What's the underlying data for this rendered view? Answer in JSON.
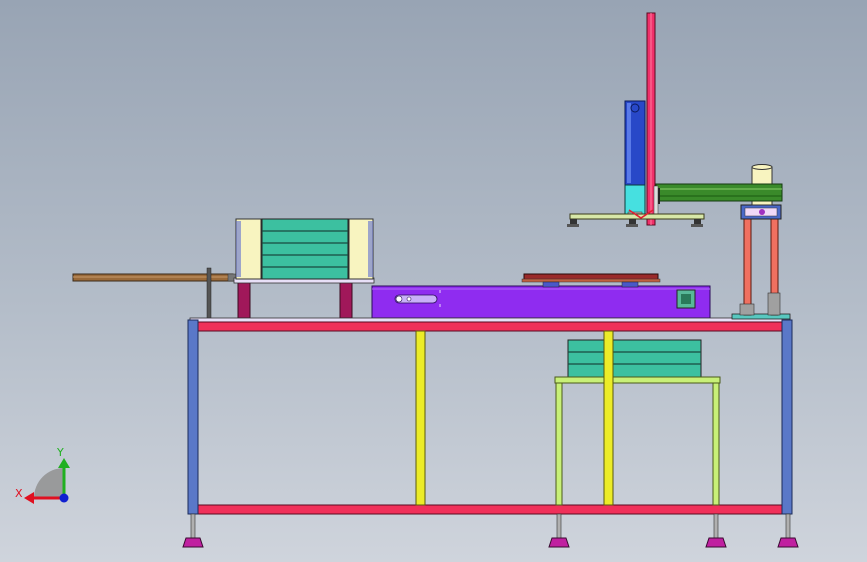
{
  "view": {
    "background_top": "#98a4b4",
    "background_bottom": "#cfd4dc"
  },
  "triad": {
    "x_label": "X",
    "y_label": "Y",
    "x_color": "#e01020",
    "y_color": "#20b020",
    "z_color": "#1020d0"
  },
  "colors": {
    "frame_rail": "#f0305a",
    "frame_leg": "#5a78c8",
    "inner_post": "#ecec28",
    "sub_stand": "#c8f078",
    "leveling_foot": "#c020a0",
    "platform": "#8f2cf0",
    "roller_block": "#3cc0a0",
    "cream_panel": "#f8f4c0",
    "mast": "#f0306a",
    "z_actuator": "#2848c8",
    "x_beam": "#3a8a2a",
    "support_leg": "#f07060",
    "feed_rod": "#9a6a3a",
    "tray": "#9a2a2a",
    "maroon_block": "#a0185a"
  },
  "components": [
    "machine-frame",
    "work-platform",
    "feed-rod",
    "roller-conveyor",
    "vertical-mast",
    "z-axis-actuator",
    "gripper-bar",
    "x-axis-beam",
    "right-column-unit",
    "lower-shelf-stand"
  ]
}
